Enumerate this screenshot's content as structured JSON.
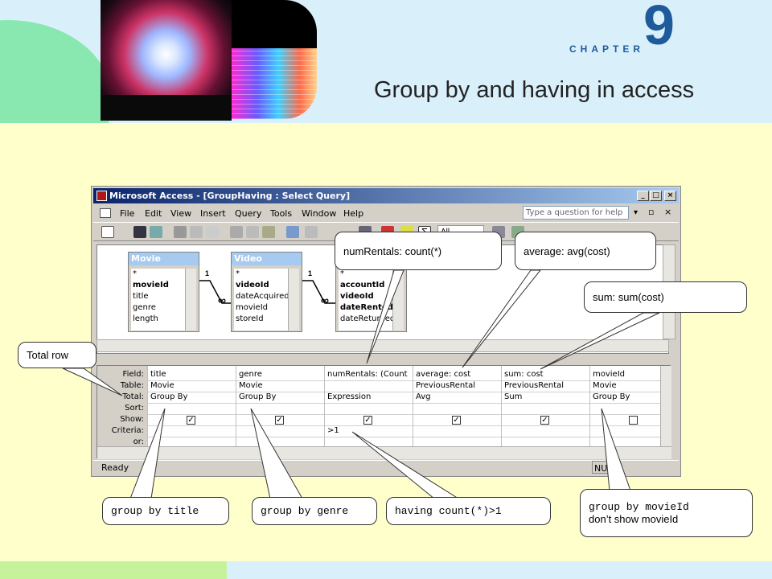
{
  "slide": {
    "chapter_label": "CHAPTER",
    "chapter_number": "9",
    "title": "Group by and having in access"
  },
  "window": {
    "title": "Microsoft Access - [GroupHaving : Select Query]",
    "controls": {
      "minimize": "_",
      "maximize": "□",
      "close": "×"
    }
  },
  "menu": {
    "items": [
      "File",
      "Edit",
      "View",
      "Insert",
      "Query",
      "Tools",
      "Window",
      "Help"
    ],
    "help_placeholder": "Type a question for help"
  },
  "toolbar": {
    "icons": [
      "view-icon",
      "save-icon",
      "print-icon",
      "cut-icon",
      "copy-icon",
      "paste-icon",
      "undo-icon",
      "sigma-totals-icon"
    ],
    "top_values": "All"
  },
  "designer": {
    "tables": [
      {
        "title": "Movie",
        "fields": [
          "*",
          "movieId",
          "title",
          "genre",
          "length"
        ],
        "bold": [
          "movieId"
        ]
      },
      {
        "title": "Video",
        "fields": [
          "*",
          "videoId",
          "dateAcquired",
          "movieId",
          "storeId"
        ],
        "bold": [
          "videoId"
        ]
      },
      {
        "title": "",
        "fields": [
          "*",
          "accountId",
          "videoId",
          "dateRented",
          "dateReturned"
        ],
        "bold": [
          "accountId",
          "videoId",
          "dateRented"
        ]
      }
    ],
    "join_labels": {
      "one": "1",
      "many": "∞"
    }
  },
  "grid": {
    "row_labels": [
      "Field:",
      "Table:",
      "Total:",
      "Sort:",
      "Show:",
      "Criteria:",
      "or:"
    ],
    "columns": [
      {
        "field": "title",
        "table": "Movie",
        "total": "Group By",
        "show": true,
        "criteria": ""
      },
      {
        "field": "genre",
        "table": "Movie",
        "total": "Group By",
        "show": true,
        "criteria": ""
      },
      {
        "field": "numRentals: (Count",
        "table": "",
        "total": "Expression",
        "show": true,
        "criteria": ">1"
      },
      {
        "field": "average: cost",
        "table": "PreviousRental",
        "total": "Avg",
        "show": true,
        "criteria": ""
      },
      {
        "field": "sum: cost",
        "table": "PreviousRental",
        "total": "Sum",
        "show": true,
        "criteria": ""
      },
      {
        "field": "movieId",
        "table": "Movie",
        "total": "Group By",
        "show": false,
        "criteria": ""
      }
    ]
  },
  "status": {
    "left": "Ready",
    "right": "NUM"
  },
  "callouts": {
    "total_row": "Total row",
    "num_rentals": "numRentals: count(*)",
    "average": "average: avg(cost)",
    "sum": "sum: sum(cost)",
    "group_by_title": "group by title",
    "group_by_genre": "group by genre",
    "having_count": "having count(*)>1",
    "group_by_movieid_line1": "group by movieId",
    "group_by_movieid_line2": "don’t show movieId"
  },
  "colors": {
    "header_bg": "#d9f0fb",
    "body_bg": "#ffffcc",
    "accent": "#1f5b9a",
    "titlebar": "#0a246a"
  }
}
